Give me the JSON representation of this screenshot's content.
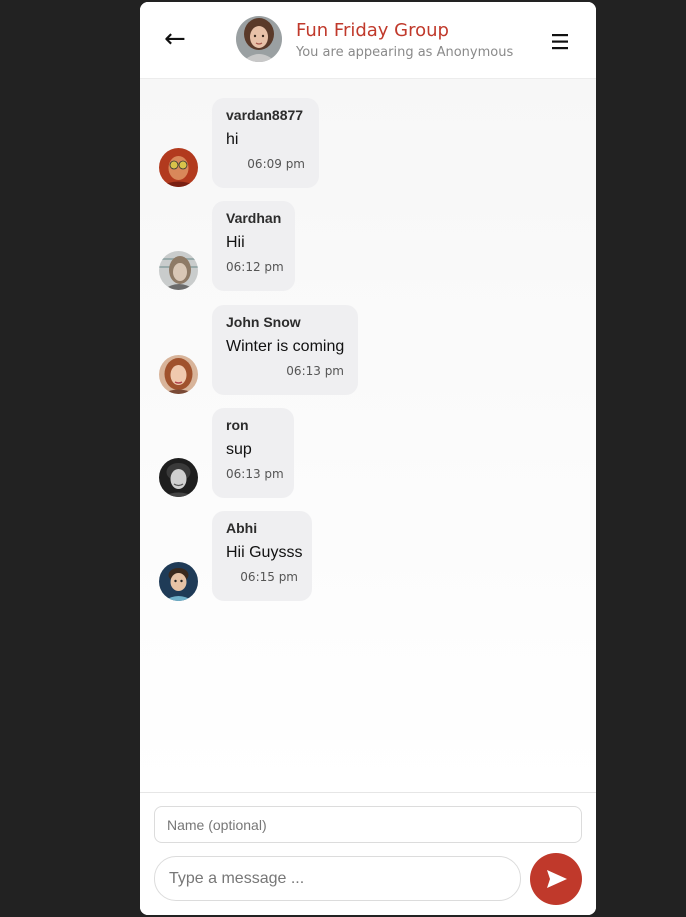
{
  "header": {
    "back_icon": "back-arrow-icon",
    "back_glyph": "←",
    "title": "Fun Friday Group",
    "subtitle": "You are appearing as Anonymous",
    "menu_icon": "hamburger-menu-icon"
  },
  "messages": [
    {
      "sender": "vardan8877",
      "text": "hi",
      "time": "06:09 pm"
    },
    {
      "sender": "Vardhan",
      "text": "Hii",
      "time": "06:12 pm"
    },
    {
      "sender": "John Snow",
      "text": "Winter is coming",
      "time": "06:13 pm"
    },
    {
      "sender": "ron",
      "text": "sup",
      "time": "06:13 pm"
    },
    {
      "sender": "Abhi",
      "text": "Hii Guysss",
      "time": "06:15 pm"
    }
  ],
  "composer": {
    "name_placeholder": "Name (optional)",
    "message_placeholder": "Type a message ...",
    "send_icon": "send-icon"
  },
  "colors": {
    "accent": "#c0392b",
    "bubble": "#efeff1",
    "page_background": "#222222"
  }
}
